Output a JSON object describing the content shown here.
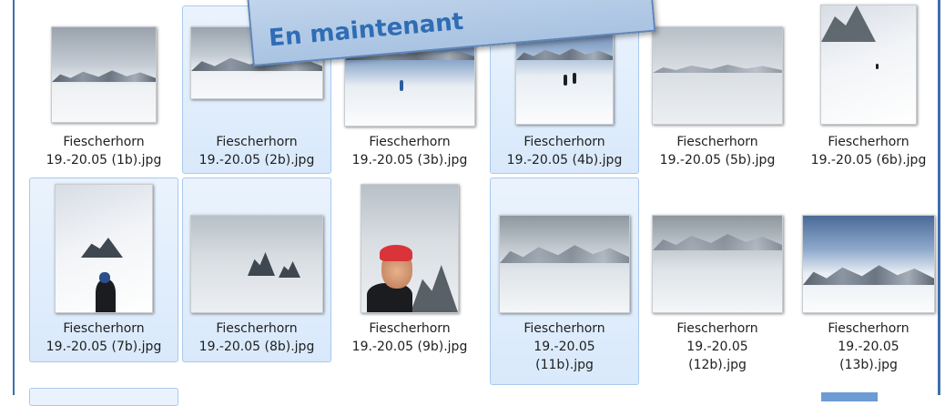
{
  "banner": {
    "text": "En maintenant"
  },
  "files": [
    {
      "line1": "Fiescherhorn",
      "line2": "19.-20.05 (1b).jpg",
      "line3": "",
      "selected": false,
      "thumb": "cloudy-valley-icon"
    },
    {
      "line1": "Fiescherhorn",
      "line2": "19.-20.05 (2b).jpg",
      "line3": "",
      "selected": true,
      "thumb": "mountain-ridge-icon"
    },
    {
      "line1": "Fiescherhorn",
      "line2": "19.-20.05 (3b).jpg",
      "line3": "",
      "selected": false,
      "thumb": "skier-slope-icon"
    },
    {
      "line1": "Fiescherhorn",
      "line2": "19.-20.05 (4b).jpg",
      "line3": "",
      "selected": true,
      "thumb": "two-skiers-icon"
    },
    {
      "line1": "Fiescherhorn",
      "line2": "19.-20.05 (5b).jpg",
      "line3": "",
      "selected": false,
      "thumb": "snowfield-icon"
    },
    {
      "line1": "Fiescherhorn",
      "line2": "19.-20.05 (6b).jpg",
      "line3": "",
      "selected": false,
      "thumb": "steep-slope-icon"
    },
    {
      "line1": "Fiescherhorn",
      "line2": "19.-20.05 (7b).jpg",
      "line3": "",
      "selected": true,
      "thumb": "climber-icon"
    },
    {
      "line1": "Fiescherhorn",
      "line2": "19.-20.05 (8b).jpg",
      "line3": "",
      "selected": true,
      "thumb": "misty-rocks-icon"
    },
    {
      "line1": "Fiescherhorn",
      "line2": "19.-20.05 (9b).jpg",
      "line3": "",
      "selected": false,
      "thumb": "selfie-icon"
    },
    {
      "line1": "Fiescherhorn",
      "line2": "19.-20.05",
      "line3": "(11b).jpg",
      "selected": true,
      "thumb": "glacier-icon"
    },
    {
      "line1": "Fiescherhorn",
      "line2": "19.-20.05",
      "line3": "(12b).jpg",
      "selected": false,
      "thumb": "glacier-crevasse-icon"
    },
    {
      "line1": "Fiescherhorn",
      "line2": "19.-20.05",
      "line3": "(13b).jpg",
      "selected": false,
      "thumb": "sunny-glacier-icon"
    }
  ],
  "colors": {
    "selection_bg": "#dcebfc",
    "selection_border": "#a9c9ef",
    "frame": "#3d6fae",
    "banner_text": "#2f6db4"
  }
}
